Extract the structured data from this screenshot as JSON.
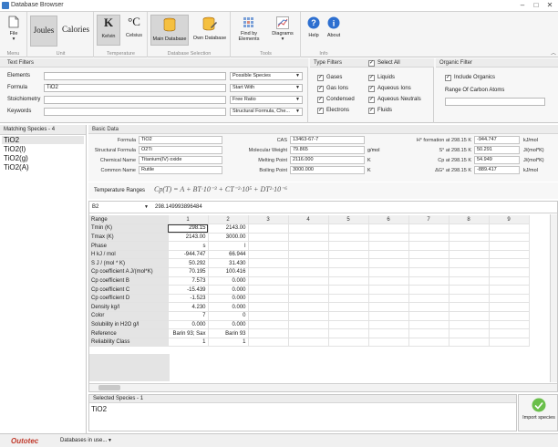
{
  "window": {
    "title": "Database Browser"
  },
  "ribbon": {
    "file_label": "File",
    "menu_group": "Menu",
    "units": [
      "Joules",
      "Calories"
    ],
    "unit_group": "Unit",
    "temp_kelvin_symbol": "K",
    "temp_celsius_symbol": "°C",
    "temp_kelvin_label": "Kelvin",
    "temp_celsius_label": "Celsius",
    "temp_group": "Temperature",
    "main_db": "Main Database",
    "own_db": "Own Database",
    "db_group": "Database Selection",
    "find_by": "Find by Elements",
    "diagrams": "Diagrams",
    "tools_group": "Tools",
    "help": "Help",
    "about": "About",
    "info_group": "Info"
  },
  "text_filters": {
    "header": "Text Filters",
    "rows": [
      {
        "label": "Elements",
        "value": "",
        "mode": "Possible Species"
      },
      {
        "label": "Formula",
        "value": "TiO2",
        "mode": "Start With"
      },
      {
        "label": "Stoichiometry",
        "value": "",
        "mode": "Free Ratio"
      },
      {
        "label": "Keywords",
        "value": "",
        "mode": "Structural Formula, Che..."
      }
    ]
  },
  "type_filters": {
    "header": "Type Filters",
    "select_all": "Select All",
    "col1": [
      "Gases",
      "Gas Ions",
      "Condensed",
      "Electrons"
    ],
    "col2": [
      "Liquids",
      "Aqueous Ions",
      "Aqueous Neutrals",
      "Fluids"
    ]
  },
  "organic_filter": {
    "header": "Organic Filter",
    "include": "Include Organics",
    "range_label": "Range Of Carbon Atoms",
    "range_value": ""
  },
  "matching": {
    "header": "Matching Species - 4",
    "items": [
      "TiO2",
      "TiO2(l)",
      "TiO2(g)",
      "TiO2(A)"
    ]
  },
  "basic": {
    "header": "Basic Data",
    "formula_label": "Formula",
    "formula": "TiO2",
    "structural_label": "Structural Formula",
    "structural": "O2Ti",
    "chemical_label": "Chemical Name",
    "chemical": "Titanium(IV) oxide",
    "common_label": "Common Name",
    "common": "Rutile",
    "cas_label": "CAS",
    "cas": "13463-67-7",
    "mw_label": "Molecular Weight",
    "mw": "79.865",
    "mw_unit": "g/mol",
    "mp_label": "Melting Point",
    "mp": "2116.000",
    "mp_unit": "K",
    "bp_label": "Boiling Point",
    "bp": "3000.000",
    "bp_unit": "K",
    "hf_label": "H° formation at 298.15 K",
    "hf": "-944.747",
    "hf_unit": "kJ/mol",
    "s_label": "S° at 298.15 K",
    "s": "50.291",
    "s_unit": "J/(mol*K)",
    "cp_label": "Cp at 298.15 K",
    "cp": "54.949",
    "cp_unit": "J/(mol*K)",
    "g_label": "ΔG° at 298.15 K",
    "g": "-889.417",
    "g_unit": "kJ/mol"
  },
  "temp_ranges": {
    "header": "Temperature Ranges",
    "equation": "Cp(T) = A + BT·10⁻³ + CT⁻²·10⁵ + DT²·10⁻⁶"
  },
  "grid": {
    "cell_ref": "B2",
    "cell_value": "298.149993896484",
    "col_headers": [
      "1",
      "2",
      "3",
      "4",
      "5",
      "6",
      "7",
      "8",
      "9"
    ],
    "rows": [
      {
        "label": "Range",
        "v1": "",
        "v2": ""
      },
      {
        "label": "Tmin (K)",
        "v1": "298.15",
        "v2": "2143.00"
      },
      {
        "label": "Tmax (K)",
        "v1": "2143.00",
        "v2": "3000.00"
      },
      {
        "label": "Phase",
        "v1": "s",
        "v2": "l"
      },
      {
        "label": "H kJ / mol",
        "v1": "-944.747",
        "v2": "66.944"
      },
      {
        "label": "S J / (mol * K)",
        "v1": "50.292",
        "v2": "31.430"
      },
      {
        "label": "Cp coefficient A J/(mol*K)",
        "v1": "70.195",
        "v2": "100.416"
      },
      {
        "label": "Cp coefficient B",
        "v1": "7.573",
        "v2": "0.000"
      },
      {
        "label": "Cp coefficient C",
        "v1": "-15.439",
        "v2": "0.000"
      },
      {
        "label": "Cp coefficient D",
        "v1": "-1.523",
        "v2": "0.000"
      },
      {
        "label": "Density kg/l",
        "v1": "4.230",
        "v2": "0.000"
      },
      {
        "label": "Color",
        "v1": "7",
        "v2": "0"
      },
      {
        "label": "Solubility in H2O g/l",
        "v1": "0.000",
        "v2": "0.000"
      },
      {
        "label": "Reference",
        "v1": "Barin 93; Sax",
        "v2": "Barin 93"
      },
      {
        "label": "Reliability Class",
        "v1": "1",
        "v2": "1"
      }
    ]
  },
  "selected": {
    "header": "Selected Species - 1",
    "item": "TiO2",
    "import_label": "Import species"
  },
  "status": {
    "brand": "Outotec",
    "db_text": "Databases in use..."
  }
}
